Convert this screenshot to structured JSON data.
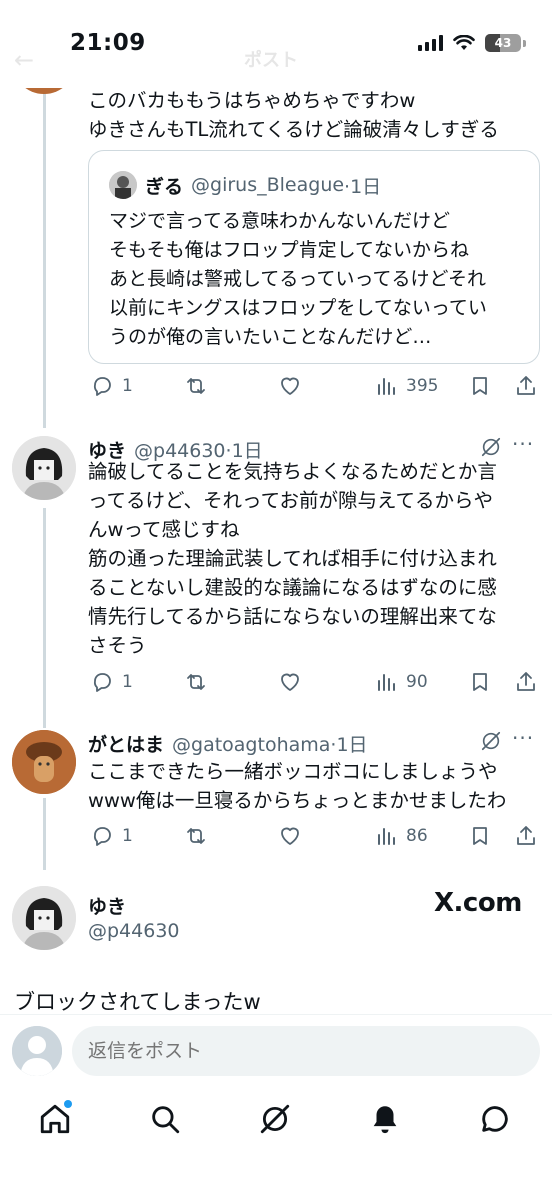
{
  "status_bar": {
    "time": "21:09",
    "battery": "43"
  },
  "header": {
    "title": "ポスト"
  },
  "post1": {
    "text": "このバカももうはちゃめちゃですわw\nゆきさんもTL流れてくるけど論破清々しすぎる",
    "quote": {
      "name": "ぎる",
      "handle": "@girus_Bleague",
      "time": "·1日",
      "text": "マジで言ってる意味わかんないんだけど\nそもそも俺はフロップ肯定してないからね\nあと長崎は警戒してるっていってるけどそれ\n以前にキングスはフロップをしてないってい\nうのが俺の言いたいことなんだけど…"
    },
    "actions": {
      "replies": "1",
      "views": "395"
    }
  },
  "post2": {
    "name": "ゆき",
    "handle": "@p44630",
    "time": "·1日",
    "text": "論破してることを気持ちよくなるためだとか言\nってるけど、それってお前が隙与えてるからや\nんwって感じすね\n筋の通った理論武装してれば相手に付け込まれ\nることないし建設的な議論になるはずなのに感\n情先行してるから話にならないの理解出来てな\nさそう",
    "actions": {
      "replies": "1",
      "views": "90"
    }
  },
  "post3": {
    "name": "がとはま",
    "handle": "@gatoagtohama",
    "time": "·1日",
    "text": "ここまできたら一緒ボッコボコにしましょうや\nwww俺は一旦寝るからちょっとまかせましたわ",
    "actions": {
      "replies": "1",
      "views": "86"
    }
  },
  "post4": {
    "name": "ゆき",
    "handle": "@p44630",
    "text": "ブロックされてしまったw",
    "watermark": "X.com"
  },
  "reply": {
    "placeholder": "返信をポスト"
  },
  "icons": {
    "reply": "reply-icon",
    "repost": "repost-icon",
    "like": "heart-icon",
    "views": "views-icon",
    "bookmark": "bookmark-icon",
    "share": "share-icon",
    "grok": "grok-icon",
    "more": "more-icon",
    "nav": [
      "home-icon",
      "search-icon",
      "grok-icon",
      "notifications-icon",
      "messages-icon"
    ]
  },
  "colors": {
    "accent": "#1d9bf0",
    "text": "#0f1419",
    "secondary": "#536471",
    "border": "#cfd9de"
  }
}
